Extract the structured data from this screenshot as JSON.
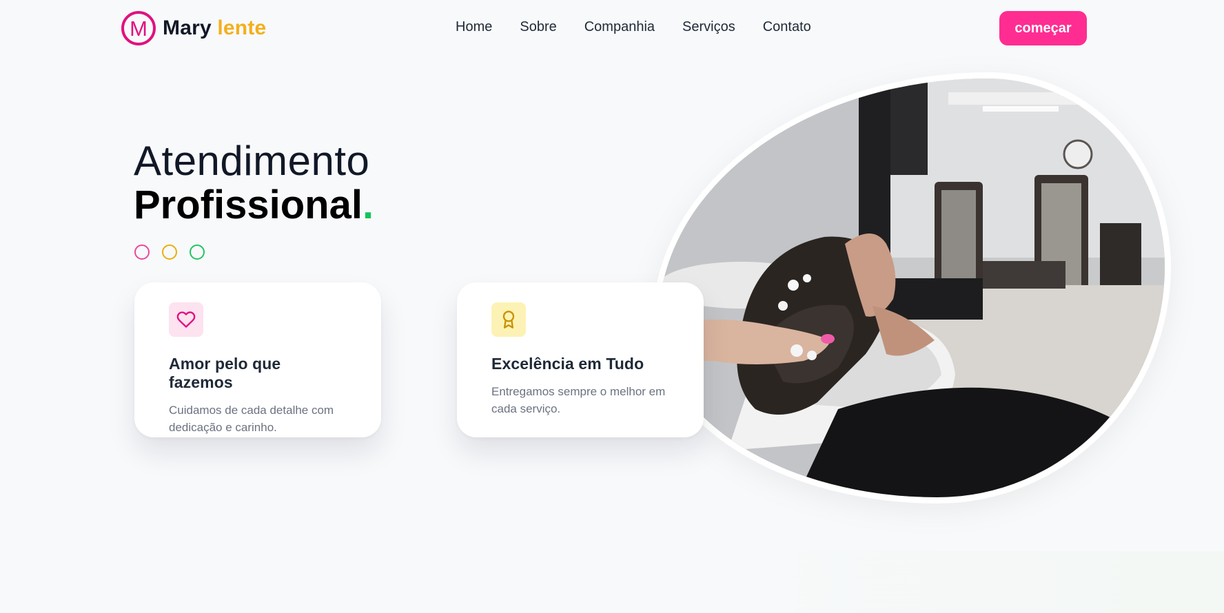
{
  "header": {
    "logo": {
      "letter": "M",
      "first": "Mary",
      "second": "lente"
    },
    "nav": [
      "Home",
      "Sobre",
      "Companhia",
      "Serviços",
      "Contato"
    ],
    "cta_label": "começar"
  },
  "hero": {
    "title_line1": "Atendimento",
    "title_line2": "Profissional",
    "title_dot": "."
  },
  "features": [
    {
      "icon": "heart-icon",
      "title": "Amor pelo que fazemos",
      "text": "Cuidamos de cada detalhe com dedicação e carinho."
    },
    {
      "icon": "award-icon",
      "title": "Excelência em Tudo",
      "text": "Entregamos sempre o melhor em cada serviço."
    }
  ],
  "colors": {
    "brand_pink": "#ff2d92",
    "logo_magenta": "#e0117f",
    "logo_yellow": "#f2b01e",
    "accent_green": "#11c45a",
    "background": "#f8f9fb"
  }
}
